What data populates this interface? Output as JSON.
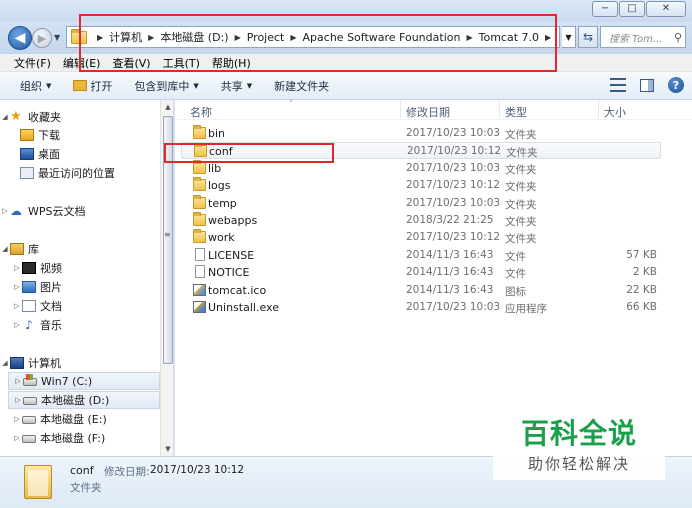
{
  "window": {
    "controls": {
      "minimize": "−",
      "maximize": "□",
      "close": "✕"
    }
  },
  "navigation": {
    "breadcrumbs": [
      "计算机",
      "本地磁盘 (D:)",
      "Project",
      "Apache Software Foundation",
      "Tomcat 7.0"
    ],
    "search_placeholder": "搜索 Tom..."
  },
  "menubar": [
    "文件(F)",
    "编辑(E)",
    "查看(V)",
    "工具(T)",
    "帮助(H)"
  ],
  "toolbar": {
    "organize": "组织",
    "open": "打开",
    "include_library": "包含到库中",
    "share": "共享",
    "new_folder": "新建文件夹"
  },
  "sidebar": {
    "favorites": {
      "label": "收藏夹",
      "items": [
        "下载",
        "桌面",
        "最近访问的位置"
      ]
    },
    "wps": "WPS云文档",
    "libraries": {
      "label": "库",
      "items": [
        "视频",
        "图片",
        "文档",
        "音乐"
      ]
    },
    "computer": {
      "label": "计算机",
      "items": [
        "Win7 (C:)",
        "本地磁盘 (D:)",
        "本地磁盘 (E:)",
        "本地磁盘 (F:)"
      ]
    }
  },
  "columns": {
    "name": "名称",
    "date": "修改日期",
    "type": "类型",
    "size": "大小"
  },
  "files": [
    {
      "name": "bin",
      "date": "2017/10/23 10:03",
      "type": "文件夹",
      "size": "",
      "kind": "folder"
    },
    {
      "name": "conf",
      "date": "2017/10/23 10:12",
      "type": "文件夹",
      "size": "",
      "kind": "folder"
    },
    {
      "name": "lib",
      "date": "2017/10/23 10:03",
      "type": "文件夹",
      "size": "",
      "kind": "folder"
    },
    {
      "name": "logs",
      "date": "2017/10/23 10:12",
      "type": "文件夹",
      "size": "",
      "kind": "folder"
    },
    {
      "name": "temp",
      "date": "2017/10/23 10:03",
      "type": "文件夹",
      "size": "",
      "kind": "folder"
    },
    {
      "name": "webapps",
      "date": "2018/3/22 21:25",
      "type": "文件夹",
      "size": "",
      "kind": "folder"
    },
    {
      "name": "work",
      "date": "2017/10/23 10:12",
      "type": "文件夹",
      "size": "",
      "kind": "folder"
    },
    {
      "name": "LICENSE",
      "date": "2014/11/3 16:43",
      "type": "文件",
      "size": "57 KB",
      "kind": "file"
    },
    {
      "name": "NOTICE",
      "date": "2014/11/3 16:43",
      "type": "文件",
      "size": "2 KB",
      "kind": "file"
    },
    {
      "name": "tomcat.ico",
      "date": "2014/11/3 16:43",
      "type": "图标",
      "size": "22 KB",
      "kind": "image"
    },
    {
      "name": "Uninstall.exe",
      "date": "2017/10/23 10:03",
      "type": "应用程序",
      "size": "66 KB",
      "kind": "exe"
    }
  ],
  "details": {
    "name": "conf",
    "date_label": "修改日期:",
    "date": "2017/10/23 10:12",
    "type": "文件夹"
  },
  "watermark": {
    "title": "百科全说",
    "subtitle": "助你轻松解决"
  },
  "colors": {
    "highlight_box": "#e2272f",
    "watermark_green": "#1aa04a"
  }
}
